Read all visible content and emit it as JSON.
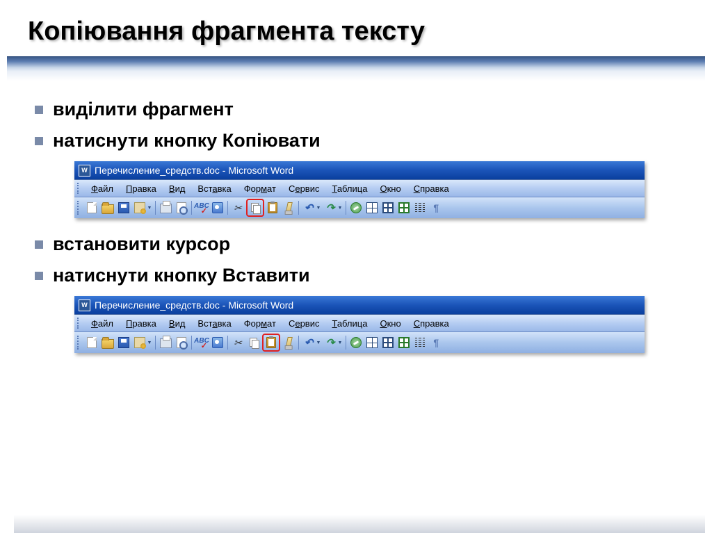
{
  "slide": {
    "title": "Копіювання фрагмента тексту",
    "bullets": [
      "виділити фрагмент",
      "натиснути кнопку Копіювати",
      "встановити курсор",
      "натиснути кнопку Вставити"
    ]
  },
  "word_window": {
    "title": "Перечисление_средств.doc - Microsoft Word",
    "menu": [
      "Файл",
      "Правка",
      "Вид",
      "Вставка",
      "Формат",
      "Сервис",
      "Таблица",
      "Окно",
      "Справка"
    ]
  },
  "highlight": {
    "screenshot1": "copy-button",
    "screenshot2": "paste-button"
  }
}
